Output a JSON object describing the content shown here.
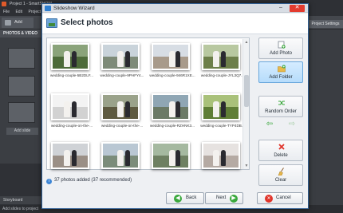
{
  "background_app": {
    "title": "Project 1 - SmartSHOW",
    "menu": [
      "File",
      "Edit",
      "Project"
    ],
    "add_label": "Add",
    "project_settings_label": "Project Settings",
    "photos_tab_label": "PHOTOS & VIDEO",
    "add_slide_label": "Add slide",
    "storyboard_label": "Storyboard",
    "status_text": "Add slides to project"
  },
  "dialog": {
    "title": "Slideshow Wizard",
    "minimize_glyph": "–",
    "close_glyph": "✕",
    "header_title": "Select photos",
    "status_text": "37 photos added (37 recommended)",
    "status_icon_glyph": "i"
  },
  "photos": [
    {
      "caption": "wedding-couple-5B2DLF...",
      "sky": "#8aa37a",
      "ground": "#4d6b3a"
    },
    {
      "caption": "wedding-couple-9PHFY4...",
      "sky": "#c9d3da",
      "ground": "#7e8b78"
    },
    {
      "caption": "wedding-couple-946R1XE...",
      "sky": "#d7dde4",
      "ground": "#a89a8a"
    },
    {
      "caption": "wedding-couple-JYL3Q7...",
      "sky": "#b8c8a0",
      "ground": "#6d7f4a"
    },
    {
      "caption": "wedding-couple-on-the-...",
      "sky": "#f3f3f3",
      "ground": "#d2d2d2"
    },
    {
      "caption": "wedding-couple-on-the-...",
      "sky": "#9aa28a",
      "ground": "#5e5a40"
    },
    {
      "caption": "wedding-couple-RZHNK3...",
      "sky": "#8fa6b4",
      "ground": "#6b7a66"
    },
    {
      "caption": "wedding-couple-TYP4DB...",
      "sky": "#a9c17a",
      "ground": "#5f7e36"
    },
    {
      "caption": "",
      "sky": "#cfd2d6",
      "ground": "#9a8f86"
    },
    {
      "caption": "",
      "sky": "#b9c7d3",
      "ground": "#7b8c7a"
    },
    {
      "caption": "",
      "sky": "#a5b9a0",
      "ground": "#6e8062"
    },
    {
      "caption": "",
      "sky": "#e6e2e0",
      "ground": "#b5aaa3"
    }
  ],
  "actions": {
    "add_photo": "Add Photo",
    "add_folder": "Add Folder",
    "random_order": "Random Order",
    "move_left_glyph": "⇦",
    "move_right_glyph": "⇨",
    "delete": "Delete",
    "clear": "Clear"
  },
  "buttons": {
    "back": "Back",
    "back_glyph": "◀",
    "next": "Next",
    "next_glyph": "▶",
    "cancel": "Cancel",
    "cancel_glyph": "✕"
  },
  "scroll_position": 0.35
}
